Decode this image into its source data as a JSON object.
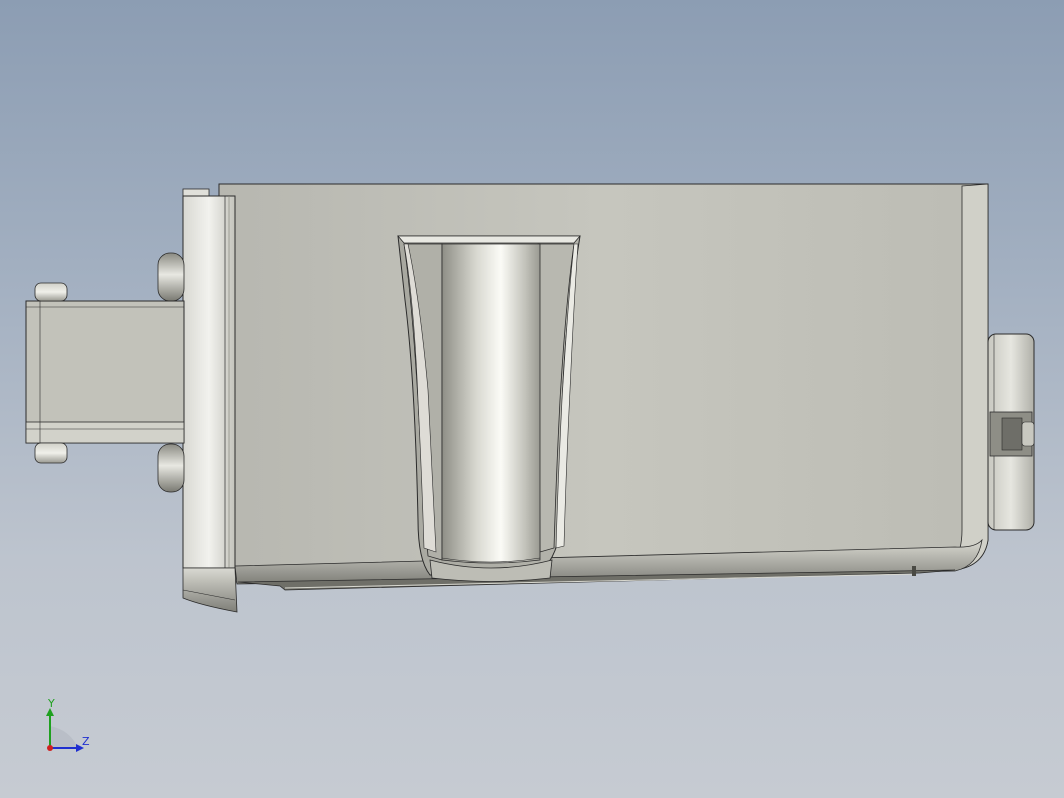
{
  "viewport": {
    "background_top": "#8c9db3",
    "background_bottom": "#c6cbd2",
    "model_colors": {
      "body": "#c8c8c0",
      "body_shadow": "#9c9c94",
      "edge": "#2b2b2b",
      "cylinder_highlight": "#f4f4ee"
    }
  },
  "triad": {
    "y_label": "Y",
    "z_label": "Z",
    "y_color": "#1fa01f",
    "z_color": "#1f2fd0",
    "x_color": "#d02020"
  }
}
